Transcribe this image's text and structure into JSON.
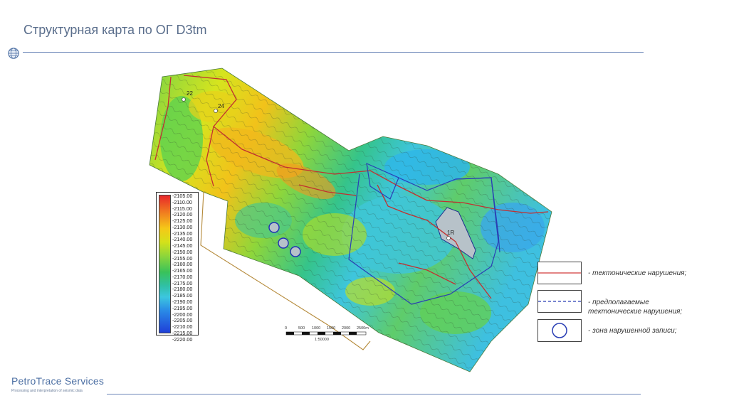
{
  "slide": {
    "title": "Структурная карта по ОГ D3tm",
    "logo_name": "PetroTrace Services",
    "logo_tagline": "Processing and interpretation of seismic data"
  },
  "colorbar": {
    "labels": [
      "-2105.00",
      "-2110.00",
      "-2115.00",
      "-2120.00",
      "-2125.00",
      "-2130.00",
      "-2135.00",
      "-2140.00",
      "-2145.00",
      "-2150.00",
      "-2155.00",
      "-2160.00",
      "-2165.00",
      "-2170.00",
      "-2175.00",
      "-2180.00",
      "-2185.00",
      "-2190.00",
      "-2195.00",
      "-2200.00",
      "-2205.00",
      "-2210.00",
      "-2215.00",
      "-2220.00"
    ],
    "colors": [
      "#e8262a",
      "#f07a20",
      "#f5c818",
      "#d4e11a",
      "#8ed63a",
      "#39c25a",
      "#30c0a6",
      "#3cc6df",
      "#2a8ae6",
      "#1f3fd8"
    ]
  },
  "scale_bar": {
    "ticks": [
      "0",
      "500",
      "1000",
      "1500",
      "2000",
      "2500m"
    ],
    "ratio": "1:50000"
  },
  "wells": {
    "w22": "22",
    "w24": "24",
    "w1r": "1R"
  },
  "legend": {
    "items": [
      {
        "label": "- тектонические нарушения;",
        "color": "#d23a3a",
        "style": "solid"
      },
      {
        "label": "- предполагаемые тектонические нарушения;",
        "color": "#2a3fb5",
        "style": "dashed"
      },
      {
        "label": "- зона нарушенной записи;",
        "color": "#2a3fb5",
        "style": "circle"
      }
    ],
    "line2_part1": "- предполагаемые",
    "line2_part2": "тектонические нарушения;"
  }
}
